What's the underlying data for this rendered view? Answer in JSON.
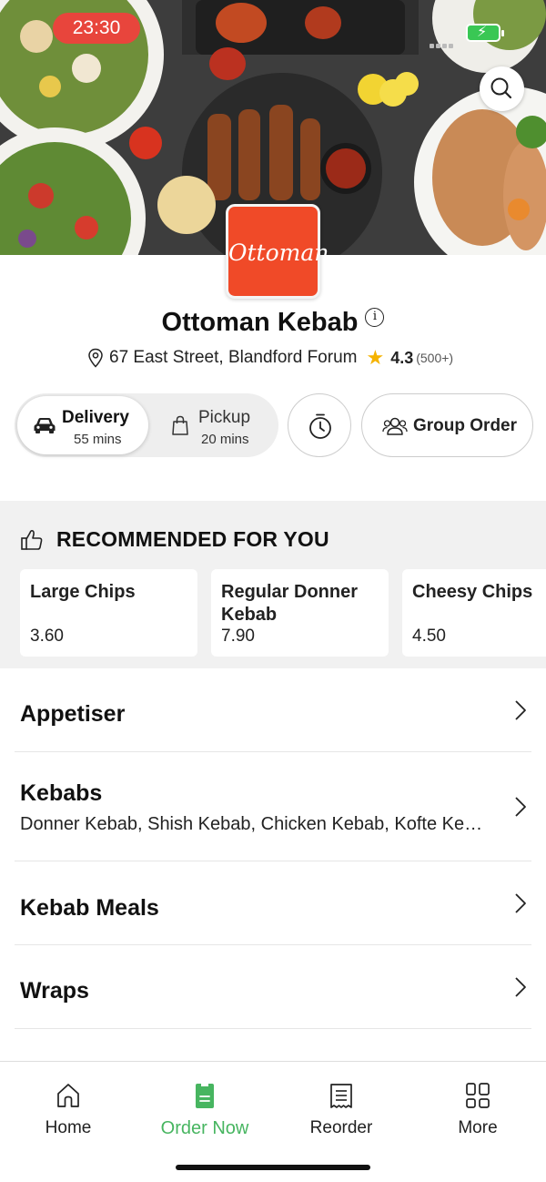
{
  "status_bar": {
    "time": "23:30"
  },
  "restaurant": {
    "logo_text": "Ottoman",
    "name": "Ottoman Kebab",
    "address": "67 East Street, Blandford Forum",
    "rating": "4.3",
    "rating_count": "(500+)"
  },
  "modes": {
    "delivery": {
      "label": "Delivery",
      "time": "55 mins"
    },
    "pickup": {
      "label": "Pickup",
      "time": "20 mins"
    },
    "group_order_label": "Group Order"
  },
  "recommended": {
    "title": "RECOMMENDED FOR YOU",
    "items": [
      {
        "name": "Large Chips",
        "price": "3.60"
      },
      {
        "name": "Regular Donner Kebab",
        "price": "7.90"
      },
      {
        "name": "Cheesy Chips",
        "price": "4.50"
      }
    ]
  },
  "categories": [
    {
      "title": "Appetiser",
      "description": ""
    },
    {
      "title": "Kebabs",
      "description": "Donner Kebab, Shish Kebab, Chicken Kebab, Kofte Ke…"
    },
    {
      "title": "Kebab Meals",
      "description": ""
    },
    {
      "title": "Wraps",
      "description": ""
    }
  ],
  "bottom_nav": [
    {
      "label": "Home",
      "icon": "home-icon"
    },
    {
      "label": "Order Now",
      "icon": "order-icon",
      "active": true
    },
    {
      "label": "Reorder",
      "icon": "receipt-icon"
    },
    {
      "label": "More",
      "icon": "grid-icon"
    }
  ],
  "colors": {
    "accent_green": "#47b560",
    "logo_red": "#f04a28",
    "star": "#f5b300",
    "time_pill": "#e8453c"
  }
}
